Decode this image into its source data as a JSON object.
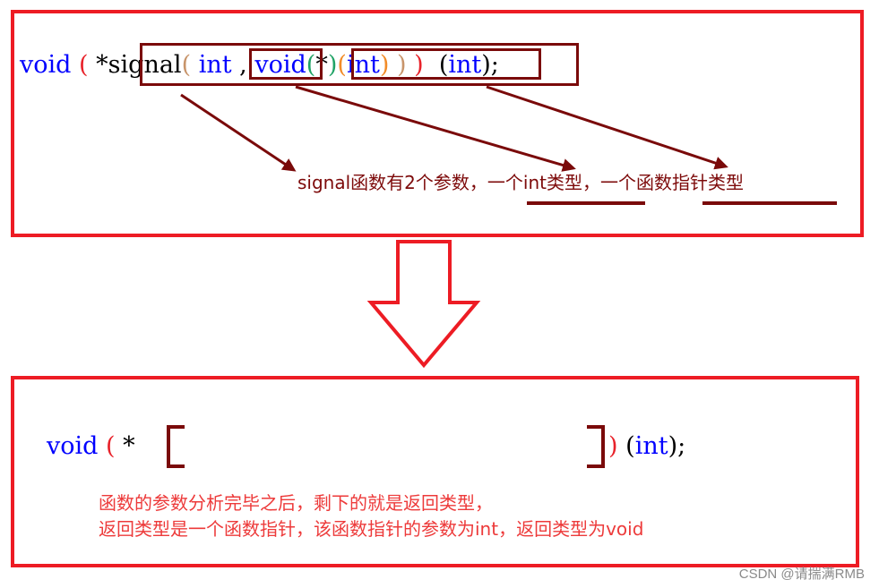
{
  "colors": {
    "frame": "#ed1c24",
    "box": "#7a0a0a",
    "keyword": "#0000ff",
    "annotation_dark": "#7d0a0a",
    "annotation_red": "#ed3a3a"
  },
  "top": {
    "code": {
      "void": "void",
      "open_paren": "(",
      "star": "*",
      "signal": "signal",
      "signal_open": "(",
      "param1": " int ",
      "comma": ",",
      "param2_void": "void",
      "param2_open1": "(",
      "param2_star": "*",
      "param2_close1": ")",
      "param2_open2": "(",
      "param2_int": "int",
      "param2_close2": ")",
      "signal_close": ")",
      "close_paren": ")",
      "ret_params": "(int);"
    },
    "annotation": {
      "part1": "signal函数有2个参数，",
      "part2": "一个int类型，",
      "part3": "一个函数指针类型"
    }
  },
  "bottom": {
    "code": {
      "void": "void",
      "open_paren": "(",
      "star": "*",
      "close_paren": ")",
      "ret_params": "(int);"
    },
    "explanation": {
      "line1": "函数的参数分析完毕之后，剩下的就是返回类型，",
      "line2": "返回类型是一个函数指针，该函数指针的参数为int，返回类型为void"
    }
  },
  "watermark": "CSDN @请揣满RMB"
}
